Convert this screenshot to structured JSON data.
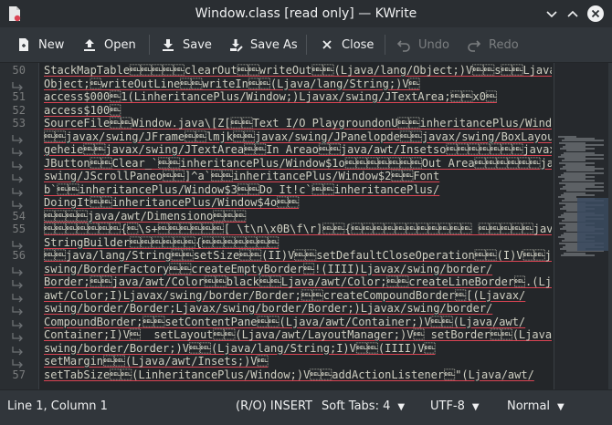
{
  "window": {
    "title": "Window.class [read only] — KWrite"
  },
  "toolbar": {
    "new_label": "New",
    "open_label": "Open",
    "save_label": "Save",
    "save_as_label": "Save As",
    "close_label": "Close",
    "undo_label": "Undo",
    "redo_label": "Redo"
  },
  "editor": {
    "line_numbers": [
      "50",
      "51",
      "52",
      "53",
      "54",
      "55",
      "56",
      "57"
    ],
    "lines": [
      "StackMapTable\u0007\u0007\u0007\u0007\u0007clearOut\u0007\u0007writeOut\u0007\u0007(Ljava/lang/Object;)V\u0007\u0007s\u0007\u0007Ljava/lang/",
      "Object;\u0007writeOutLine\u0007\u0007writeIn\u0007\u0007(Ljava/lang/String;)V\u0007",
      "access$000\u00071(LinheritancePlus/Window;)Ljavax/swing/JTextArea;\u0007\u0007x0\u0007",
      "access$100\u0007",
      "SourceFile\u0007\u0007Window.java\\[Z[\u0007\u0007Text I/O PlaygroundonU\u0007\u0007inheritancePlus/Window",
      "\u0007\u0007javax/swing/JFrame\u0007\u0007lmjk\u0007\u0007javax/swing/JPanelopde\u0007\u0007javax/swing/BoxLayoutofe",
      "geheie\u0007\u0007javax/swing/JTextArea\u0007\u0007In Areao\u0007\u0007java/awt/Insetso\u0007\u0007\u0007\u0007\u0007\u0007\u0007javax/swing/",
      "JButton\u0007\u0007Clear_`\u0007\u0007inheritancePlus/Window$1o\u0007\u0007\u0007\u0007\u0007\u0007\u0007Out Area\u0007\u0007\u0007\u0007\u0007\u0007javax/",
      "swing/JScrollPaneo\u0007\u0007]^a`\u0007\u0007inheritancePlus/Window$2\u0007\u0007Font",
      "b`\u0007\u0007inheritancePlus/Window$3\u0007\u0007Do It!c`\u0007\u0007inheritancePlus/",
      "DoingIt\u0007\u0007inheritancePlus/Window$4o\u0007\u0007",
      "\u0007\u0007\u0007\u0007java/awt/Dimensiono\u0007\u0007\u0007",
      "\u0007\u0007\u0007\u0007\u0007\u0007\u0007{\u0007\\s+\u0007\u0007\u0007\u0007\u0007\u0007[ \\t\\n\\x0B\\f\\r]\u0007\u0007{\u0007\u0007\u0007\u0007\u0007\u0007\u0007\u0007\u0007\u0007\u0007 \u0007\u0007\u0007\u0007\u0007java/lang/",
      "StringBuilder\u0007\u0007\u0007\u0007\u0007\u0007{\u0007\u0007\u0007\u0007\u0007\u0007\u0007",
      "\u0007\u0007java/lang/String\u0007\u0007setSize\u0007\u0007(II)V\u0007\u0007setDefaultCloseOperation\u0007\u0007(I)V\u0007\u0007javax/",
      "swing/BorderFactory\u0007\u0007createEmptyBorder\u0007!(IIII)Ljavax/swing/border/",
      "Border;\u0007\u0007java/awt/Color\u0007\u0007black\u0007\u0007Ljava/awt/Color;\u0007\u0007createLineBorder\u0007.(Ljava/",
      "awt/Color;I)Ljavax/swing/border/Border;\u0007\u0007createCompoundBorder\u0007[(Ljavax/",
      "swing/border/Border;Ljavax/swing/border/Border;)Ljavax/swing/border/",
      "CompoundBorder;\u0007\u0007setContentPane\u0007\u0007(Ljava/awt/Container;)V\u0007\u0007(Ljava/awt/",
      "Container;I)V\u0007  setLayout\u0007\u0007(Ljava/awt/LayoutManager;)V\u0007 setBorder\u0007\u0007(Ljavax/",
      "swing/border/Border;)V\u0007\u0007(Ljava/lang/String;I)V\u0007\u0007(IIII)V\u0007",
      "setMargin\u0007\u0007(Ljava/awt/Insets;)V\u0007",
      "setTabSize\u0007\u0007(LinheritancePlus/Window;)V\u0007\u0007addActionListener\u0007\"(Ljava/awt/"
    ]
  },
  "statusbar": {
    "cursor": "Line 1, Column 1",
    "mode": "(R/O) INSERT",
    "indent": "Soft Tabs: 4",
    "encoding": "UTF-8",
    "syntax": "Normal"
  }
}
